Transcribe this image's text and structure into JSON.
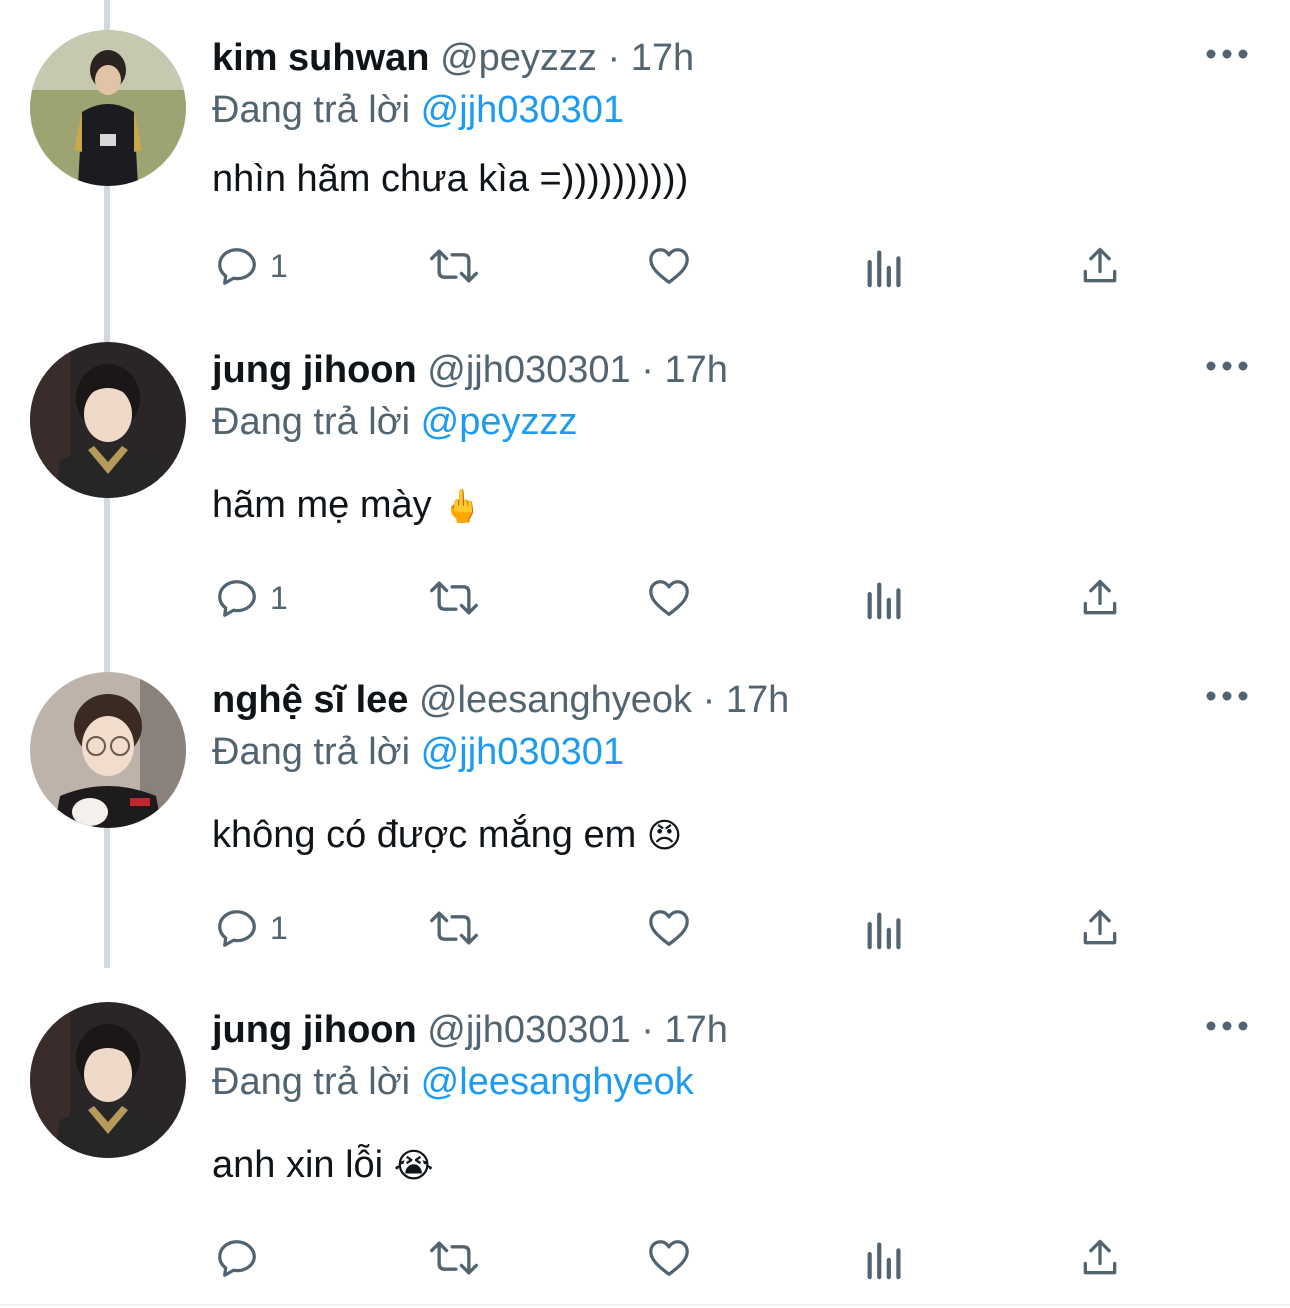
{
  "reply_prefix": "Đang trả lời",
  "tweets": [
    {
      "name": "kim suhwan",
      "handle": "@peyzzz",
      "time": "17h",
      "reply_to": "@jjh030301",
      "text": "nhìn hãm chưa kìa =))))))))))",
      "emoji": "",
      "reply_count": "1",
      "avatar": "avatar-kim-suhwan"
    },
    {
      "name": "jung jihoon",
      "handle": "@jjh030301",
      "time": "17h",
      "reply_to": "@peyzzz",
      "text": "hãm mẹ mày",
      "emoji": "🖕",
      "reply_count": "1",
      "avatar": "avatar-jung-jihoon"
    },
    {
      "name": "nghệ sĩ lee",
      "handle": "@leesanghyeok",
      "time": "17h",
      "reply_to": "@jjh030301",
      "text": "không có được mắng em",
      "emoji": "😠",
      "reply_count": "1",
      "avatar": "avatar-nghe-si-lee"
    },
    {
      "name": "jung jihoon",
      "handle": "@jjh030301",
      "time": "17h",
      "reply_to": "@leesanghyeok",
      "text": "anh xin lỗi",
      "emoji": "😭",
      "reply_count": "",
      "avatar": "avatar-jung-jihoon"
    }
  ],
  "colors": {
    "link": "#1d9bf0",
    "secondary": "#536471",
    "primary": "#0f1419",
    "thread_line": "#cfd9de"
  },
  "icons": [
    "reply-icon",
    "retweet-icon",
    "like-icon",
    "views-icon",
    "share-icon",
    "more-icon"
  ]
}
